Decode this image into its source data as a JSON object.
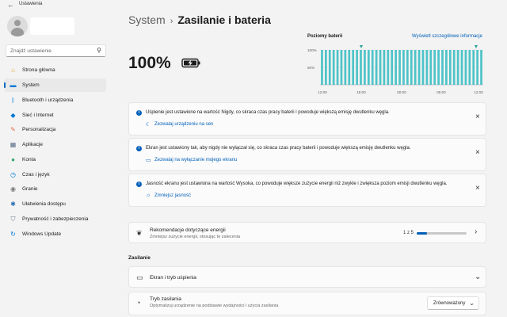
{
  "window": {
    "title": "Ustawienia",
    "back_icon": "back-arrow-icon"
  },
  "sidebar": {
    "search_placeholder": "Znajdź ustawienie",
    "items": [
      {
        "label": "Strona główna",
        "icon": "home-icon",
        "color": "#e8a33a",
        "active": false
      },
      {
        "label": "System",
        "icon": "system-icon",
        "color": "#0078d4",
        "active": true
      },
      {
        "label": "Bluetooth i urządzenia",
        "icon": "bluetooth-icon",
        "color": "#0078d4",
        "active": false
      },
      {
        "label": "Sieć i Internet",
        "icon": "wifi-icon",
        "color": "#0078d4",
        "active": false
      },
      {
        "label": "Personalizacja",
        "icon": "brush-icon",
        "color": "#e56f4a",
        "active": false
      },
      {
        "label": "Aplikacje",
        "icon": "apps-icon",
        "color": "#5a6d87",
        "active": false
      },
      {
        "label": "Konta",
        "icon": "account-icon",
        "color": "#2ea56b",
        "active": false
      },
      {
        "label": "Czas i język",
        "icon": "clock-globe-icon",
        "color": "#0078d4",
        "active": false
      },
      {
        "label": "Granie",
        "icon": "gamepad-icon",
        "color": "#7a7a7a",
        "active": false
      },
      {
        "label": "Ułatwienia dostępu",
        "icon": "accessibility-icon",
        "color": "#2b6cb0",
        "active": false
      },
      {
        "label": "Prywatność i zabezpieczenia",
        "icon": "shield-icon",
        "color": "#6b7b8c",
        "active": false
      },
      {
        "label": "Windows Update",
        "icon": "update-icon",
        "color": "#0078d4",
        "active": false
      }
    ]
  },
  "breadcrumb": {
    "root": "System",
    "separator": "›",
    "current": "Zasilanie i bateria"
  },
  "battery": {
    "percent": "100%",
    "charging": true
  },
  "levels_chart": {
    "title": "Poziomy baterii",
    "link": "Wyświetl szczegółowe informacje",
    "y_ticks": [
      "100%",
      "50%"
    ],
    "x_ticks": [
      "12:00",
      "18:00",
      "00:00",
      "06:00",
      "12:00"
    ],
    "bar_color": "#4dc3c8",
    "bar_count": 42,
    "level": 1.0
  },
  "notices": [
    {
      "text": "Uśpienie jest ustawione na wartość Nigdy, co skraca czas pracy baterii i powoduje większą emisję dwutlenku węgla.",
      "link": "Zezwalaj urządzeniu na sen",
      "link_icon": "moon-icon"
    },
    {
      "text": "Ekran jest ustawiony tak, aby nigdy nie wyłączał się, co skraca czas pracy baterii i powoduje większą emisję dwutlenku węgla.",
      "link": "Zezwalaj na wyłączanie mojego ekranu",
      "link_icon": "screen-icon"
    },
    {
      "text": "Jasność ekranu jest ustawiona na wartość Wysoka, co powoduje większe zużycie energii niż zwykle i zwiększa poziom emisji dwutlenku węgla.",
      "link": "Zmniejsz jasność",
      "link_icon": "brightness-icon"
    }
  ],
  "recommendations": {
    "title": "Rekomendacje dotyczące energii",
    "subtitle": "Zmniejsz zużycie energii, stosując te zalecenia",
    "progress_text": "1 z 5",
    "progress": 0.2
  },
  "section": {
    "title": "Zasilanie"
  },
  "screen_sleep": {
    "title": "Ekran i tryb uśpienia"
  },
  "power_mode": {
    "title": "Tryb zasilania",
    "subtitle": "Optymalizuj urządzenie na podstawie wydajności i użycia zasilania",
    "value": "Zrównoważony"
  },
  "accent_color": "#005fb8"
}
